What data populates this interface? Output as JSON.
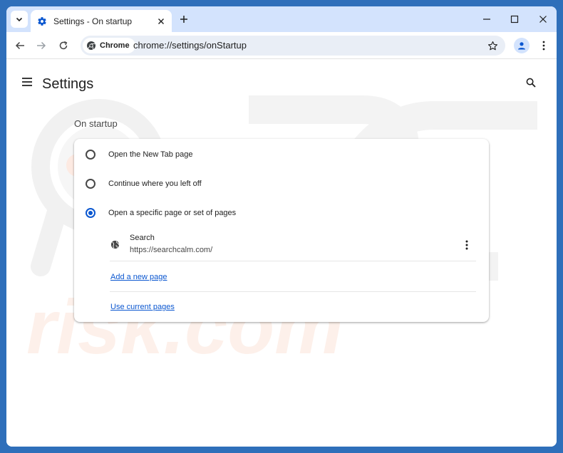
{
  "tab": {
    "title": "Settings - On startup"
  },
  "toolbar": {
    "chip_label": "Chrome",
    "url": "chrome://settings/onStartup"
  },
  "page": {
    "title": "Settings",
    "section_title": "On startup"
  },
  "startup": {
    "options": [
      {
        "label": "Open the New Tab page",
        "selected": false
      },
      {
        "label": "Continue where you left off",
        "selected": false
      },
      {
        "label": "Open a specific page or set of pages",
        "selected": true
      }
    ],
    "site": {
      "name": "Search",
      "url": "https://searchcalm.com/"
    },
    "add_link": "Add a new page",
    "use_current_link": "Use current pages"
  },
  "colors": {
    "accent": "#0b57d0",
    "frame": "#2f6fba",
    "tabstrip": "#d3e3fd"
  }
}
